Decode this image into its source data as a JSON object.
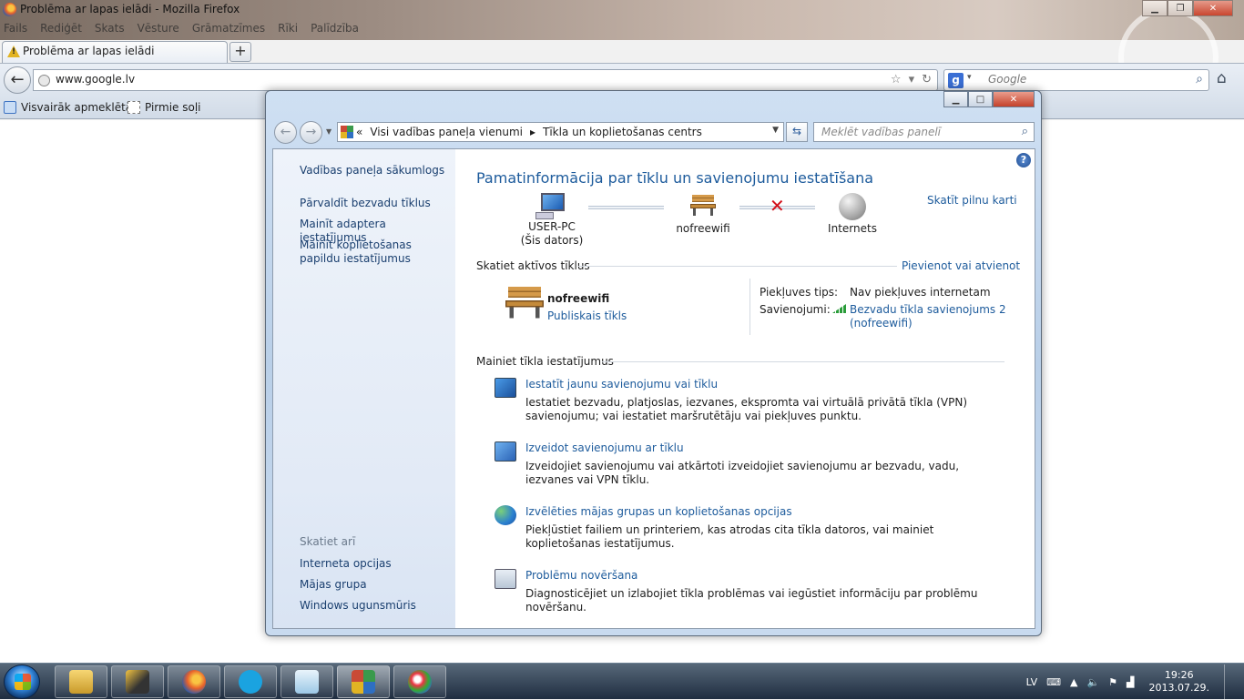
{
  "firefox": {
    "window_title": "Problēma ar lapas ielādi - Mozilla Firefox",
    "menu": [
      "Fails",
      "Rediģēt",
      "Skats",
      "Vēsture",
      "Grāmatzīmes",
      "Rīki",
      "Palīdzība"
    ],
    "tab_title": "Problēma ar lapas ielādi",
    "url": "www.google.lv",
    "search_placeholder": "Google",
    "bookmarks": [
      "Visvairāk apmeklētās",
      "Pirmie soļi"
    ]
  },
  "control_panel": {
    "breadcrumb": {
      "prefix": "«",
      "items": [
        "Visi vadības paneļa vienumi",
        "Tīkla un koplietošanas centrs"
      ],
      "separator": "▸"
    },
    "search_placeholder": "Meklēt vadības panelī",
    "sidebar": {
      "home": "Vadības paneļa sākumlogs",
      "links": [
        "Pārvaldīt bezvadu tīklus",
        "Mainīt adaptera iestatījumus",
        "Mainīt koplietošanas papildu iestatījumus"
      ],
      "see_also_title": "Skatiet arī",
      "see_also": [
        "Interneta opcijas",
        "Mājas grupa",
        "Windows ugunsmūris"
      ]
    },
    "main": {
      "title": "Pamatinformācija par tīklu un savienojumu iestatīšana",
      "full_map_link": "Skatīt pilnu karti",
      "network_map": {
        "computer_name": "USER-PC",
        "computer_sub": "(Šis dators)",
        "network_name": "nofreewifi",
        "internet_label": "Internets",
        "internet_link_broken": true
      },
      "active_networks": {
        "heading": "Skatiet aktīvos tīklus",
        "connect_link": "Pievienot vai atvienot",
        "network_name": "nofreewifi",
        "network_type": "Publiskais tīkls",
        "access_type_label": "Piekļuves tips:",
        "access_type_value": "Nav piekļuves internetam",
        "connections_label": "Savienojumi:",
        "connection_link_line1": "Bezvadu tīkla savienojums 2",
        "connection_link_line2": "(nofreewifi)"
      },
      "change_settings": {
        "heading": "Mainiet tīkla iestatījumus",
        "tasks": [
          {
            "icon": "new-connection-icon",
            "title": "Iestatīt jaunu savienojumu vai tīklu",
            "desc": "Iestatiet bezvadu, platjoslas, iezvanes, ekspromta vai virtuālā privātā tīkla (VPN) savienojumu; vai iestatiet maršrutētāju vai piekļuves punktu."
          },
          {
            "icon": "connect-to-network-icon",
            "title": "Izveidot savienojumu ar tīklu",
            "desc": "Izveidojiet savienojumu vai atkārtoti izveidojiet savienojumu ar bezvadu, vadu, iezvanes vai VPN tīklu."
          },
          {
            "icon": "homegroup-icon",
            "title": "Izvēlēties mājas grupas un koplietošanas opcijas",
            "desc": "Piekļūstiet failiem un printeriem, kas atrodas cita tīkla datoros, vai mainiet koplietošanas iestatījumus."
          },
          {
            "icon": "troubleshoot-icon",
            "title": "Problēmu novēršana",
            "desc": "Diagnosticējiet un izlabojiet tīkla problēmas vai iegūstiet informāciju par problēmu novēršanu."
          }
        ]
      }
    }
  },
  "taskbar": {
    "language": "LV",
    "time": "19:26",
    "date": "2013.07.29."
  }
}
